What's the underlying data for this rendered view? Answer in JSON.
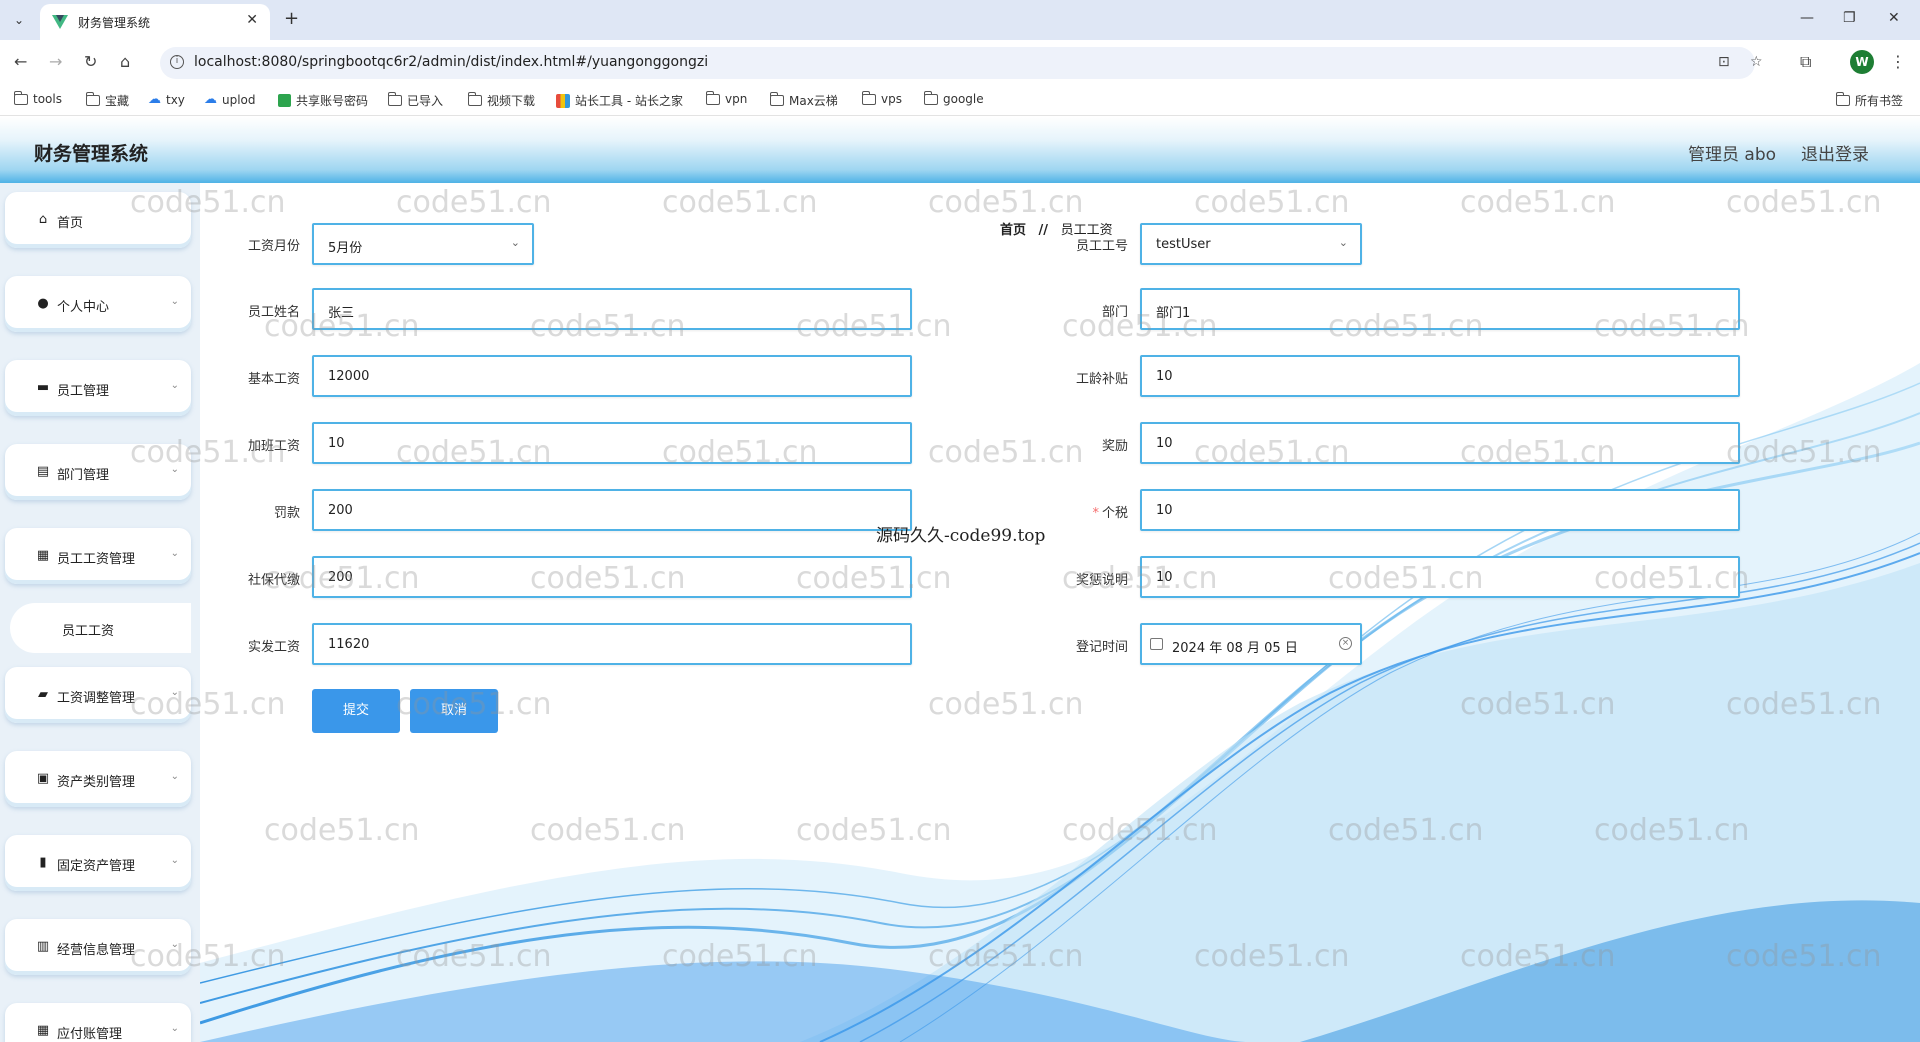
{
  "browser": {
    "tab_title": "财务管理系统",
    "url": "localhost:8080/springbootqc6r2/admin/dist/index.html#/yuangonggongzi",
    "profile_initial": "W",
    "bookmarks": [
      "tools",
      "宝藏",
      "txy",
      "uplod",
      "共享账号密码",
      "已导入",
      "视频下载",
      "站长工具 - 站长之家",
      "vpn",
      "Max云梯",
      "vps",
      "google"
    ],
    "all_bookmarks": "所有书签"
  },
  "header": {
    "title": "财务管理系统",
    "user": "管理员 abo",
    "logout": "退出登录"
  },
  "sidebar": {
    "items": [
      {
        "label": "首页",
        "icon": "home-icon"
      },
      {
        "label": "个人中心",
        "icon": "user-icon"
      },
      {
        "label": "员工管理",
        "icon": "briefcase-icon"
      },
      {
        "label": "部门管理",
        "icon": "clipboard-icon"
      },
      {
        "label": "员工工资管理",
        "icon": "grid-icon"
      },
      {
        "label": "工资调整管理",
        "icon": "ticket-icon"
      },
      {
        "label": "资产类别管理",
        "icon": "clipboard-check-icon"
      },
      {
        "label": "固定资产管理",
        "icon": "bar-chart-icon"
      },
      {
        "label": "经营信息管理",
        "icon": "bars-icon"
      },
      {
        "label": "应付账管理",
        "icon": "grid-icon"
      }
    ],
    "active_sub": "员工工资"
  },
  "breadcrumb": {
    "home": "首页",
    "sep": "//",
    "current": "员工工资"
  },
  "form": {
    "salary_month": {
      "label": "工资月份",
      "value": "5月份"
    },
    "employee_no": {
      "label": "员工工号",
      "value": "testUser"
    },
    "employee_name": {
      "label": "员工姓名",
      "value": "张三"
    },
    "department": {
      "label": "部门",
      "value": "部门1"
    },
    "base_salary": {
      "label": "基本工资",
      "value": "12000"
    },
    "seniority_allowance": {
      "label": "工龄补贴",
      "value": "10"
    },
    "overtime_pay": {
      "label": "加班工资",
      "value": "10"
    },
    "bonus": {
      "label": "奖励",
      "value": "10"
    },
    "penalty": {
      "label": "罚款",
      "value": "200"
    },
    "income_tax": {
      "label": "个税",
      "value": "10",
      "required": "*"
    },
    "social_security": {
      "label": "社保代缴",
      "value": "200"
    },
    "reward_note": {
      "label": "奖惩说明",
      "value": "10"
    },
    "net_salary": {
      "label": "实发工资",
      "value": "11620"
    },
    "register_time": {
      "label": "登记时间",
      "value": "2024 年 08 月 05 日"
    },
    "submit": "提交",
    "cancel": "取消"
  },
  "watermarks": {
    "repeat": "code51.cn",
    "center": "源码久久-code99.top"
  },
  "colors": {
    "accent": "#3a97ea",
    "field_border": "#4fb2e6",
    "header_gradient_end": "#4fb2e6",
    "sidebar_bg": "#e9f1f8"
  }
}
